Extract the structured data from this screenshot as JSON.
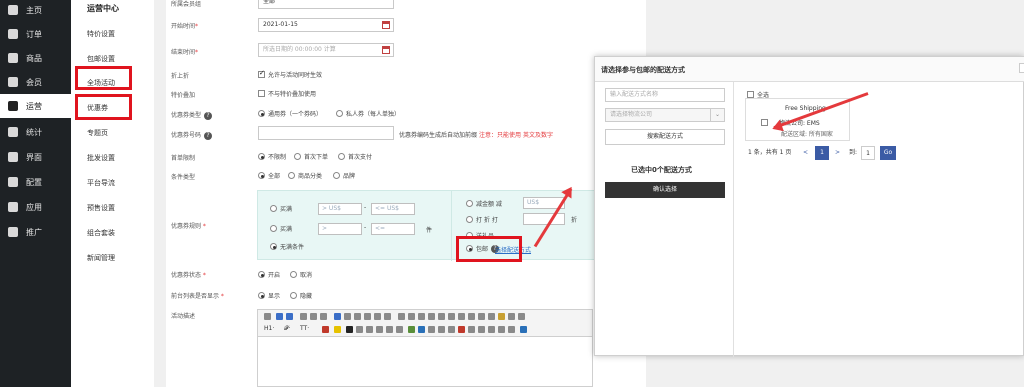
{
  "sidebar": {
    "items": [
      {
        "label": "主页",
        "icon": "home-icon"
      },
      {
        "label": "订单",
        "icon": "order-icon"
      },
      {
        "label": "商品",
        "icon": "product-icon"
      },
      {
        "label": "会员",
        "icon": "member-icon"
      },
      {
        "label": "运营",
        "icon": "megaphone-icon",
        "active": true
      },
      {
        "label": "统计",
        "icon": "bar-chart-icon"
      },
      {
        "label": "界面",
        "icon": "layout-icon"
      },
      {
        "label": "配置",
        "icon": "gear-icon"
      },
      {
        "label": "应用",
        "icon": "puzzle-icon"
      },
      {
        "label": "推广",
        "icon": "paper-plane-icon"
      }
    ]
  },
  "submenu": {
    "title": "运营中心",
    "items": [
      "特价设置",
      "包邮设置",
      "全场活动",
      "优惠券",
      "专题页",
      "批发设置",
      "平台导流",
      "预售设置",
      "组合套装",
      "新闻管理"
    ]
  },
  "form": {
    "fields": {
      "member_level": {
        "label": "所属会员组",
        "value": "全部"
      },
      "start_time": {
        "label": "开始时间",
        "value": "2021-01-15"
      },
      "end_time": {
        "label": "结束时间",
        "placeholder": "所选日期的 00:00:00 计算"
      },
      "discount": {
        "label": "折上折",
        "option": "允许与活动同时生效"
      },
      "special": {
        "label": "特价叠加",
        "option": "不与特价叠加使用"
      },
      "coupon_type": {
        "label": "优惠券类型",
        "opt1": "通用券（一个券码）",
        "opt2": "私人券（每人单独）"
      },
      "coupon_code": {
        "label": "优惠券号码",
        "hint": "优惠券编码生成后自动加前缀",
        "note_label": "注意：",
        "note": "只能使用 英文及数字"
      },
      "first_order": {
        "label": "首单限制",
        "opt1": "不限制",
        "opt2": "首次下单",
        "opt3": "首次支付"
      },
      "condition": {
        "label": "条件类型",
        "opt1": "全部",
        "opt2": "商品分类",
        "opt3": "品牌"
      },
      "rule": {
        "label": "优惠券规则",
        "buy1": "买满",
        "buy2": "买满",
        "ph_gt": "> US$",
        "ph_lte": "<= US$",
        "ph_gt2": ">",
        "ph_lte2": "<=",
        "unit": "件",
        "no_condition": "无满条件",
        "reduce": "减金额 减",
        "reduce_ph": "US$",
        "discount": "打 折 打",
        "discount_suffix": "折",
        "gift": "送礼品",
        "shipping": "包邮",
        "choose_shipping": "选择配送方式"
      },
      "status": {
        "label": "优惠券状态",
        "opt1": "开启",
        "opt2": "取消"
      },
      "front_show": {
        "label": "前台列表是否显示",
        "opt1": "显示",
        "opt2": "隐藏"
      },
      "desc": {
        "label": "活动描述"
      }
    },
    "toolbar": {
      "heading_label": "H1·",
      "font_label": "𝓕·",
      "size_label": "TT·"
    }
  },
  "modal": {
    "title": "请选择参与包邮的配送方式",
    "name_placeholder": "输入配送方式名称",
    "company_placeholder": "请选择物流公司",
    "search_button": "搜索配送方式",
    "selected_text": "已选中0个配送方式",
    "confirm_button": "确认选择",
    "select_all": "全选",
    "option": {
      "name": "Free Shipping",
      "company": "物流公司: EMS",
      "region": "配送区域: 所有国家"
    },
    "pagination": {
      "summary": "1 条，共有 1 页",
      "prev": "<",
      "current": "1",
      "next": ">",
      "goto": "到:",
      "page_input": "1",
      "go": "Go"
    }
  },
  "colors": {
    "sidebar_bg": "#1e2225",
    "highlight": "#e0141e",
    "page_button": "#3b5ba5"
  }
}
